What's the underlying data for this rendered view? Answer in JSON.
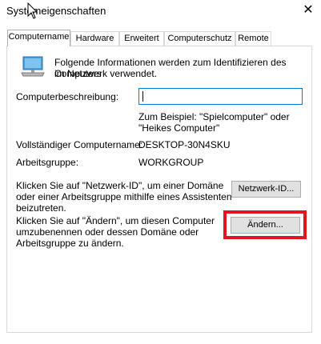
{
  "window": {
    "title": "Systemeigenschaften",
    "close_glyph": "✕"
  },
  "tabs": [
    {
      "label": "Computername",
      "active": true
    },
    {
      "label": "Hardware"
    },
    {
      "label": "Erweitert"
    },
    {
      "label": "Computerschutz"
    },
    {
      "label": "Remote"
    }
  ],
  "intro": {
    "line1": "Folgende Informationen werden zum Identifizieren des Computers",
    "line2": "im Netzwerk verwendet."
  },
  "description": {
    "label": "Computerbeschreibung:",
    "value": "",
    "hint_line1": "Zum Beispiel: \"Spielcomputer\" oder",
    "hint_line2": "\"Heikes Computer\""
  },
  "fullname": {
    "label": "Vollständiger Computername:",
    "value": "DESKTOP-30N4SKU"
  },
  "workgroup": {
    "label": "Arbeitsgruppe:",
    "value": "WORKGROUP"
  },
  "network": {
    "line1": "Klicken Sie auf \"Netzwerk-ID\", um einer Domäne",
    "line2": "oder einer Arbeitsgruppe mithilfe eines Assistenten",
    "line3": "beizutreten.",
    "button": "Netzwerk-ID..."
  },
  "change": {
    "line1": "Klicken Sie auf \"Ändern\", um diesen Computer",
    "line2": "umzubenennen oder dessen Domäne oder",
    "line3": "Arbeitsgruppe zu ändern.",
    "button": "Ändern..."
  },
  "colors": {
    "highlight": "#e3141b",
    "focus_border": "#0078d7"
  },
  "icons": [
    "computer-icon",
    "close-icon",
    "mouse-cursor-icon"
  ]
}
